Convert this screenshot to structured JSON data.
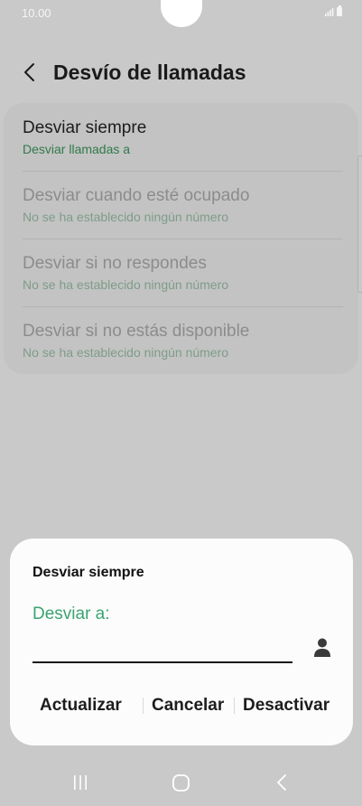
{
  "status_bar": {
    "time": "10.00"
  },
  "header": {
    "title": "Desvío de llamadas"
  },
  "list": [
    {
      "title": "Desviar siempre",
      "subtitle": "Desviar llamadas a"
    },
    {
      "title": "Desviar cuando esté ocupado",
      "subtitle": "No se ha establecido ningún número"
    },
    {
      "title": "Desviar si no respondes",
      "subtitle": "No se ha establecido ningún número"
    },
    {
      "title": "Desviar si no estás disponible",
      "subtitle": "No se ha establecido ningún número"
    }
  ],
  "dialog": {
    "title": "Desviar siempre",
    "label": "Desviar a:",
    "input_value": "",
    "buttons": {
      "update": "Actualizar",
      "cancel": "Cancelar",
      "deactivate": "Desactivar"
    }
  },
  "colors": {
    "accent": "#3aa470",
    "subtitle_active": "#2f7a4a",
    "overlay_background": "#c9c9c9",
    "dialog_background": "#fcfcfc"
  },
  "icons": {
    "back": "chevron-left-icon",
    "contact": "person-icon",
    "nav_recents": "recents-icon",
    "nav_home": "home-icon",
    "nav_back": "back-icon"
  }
}
